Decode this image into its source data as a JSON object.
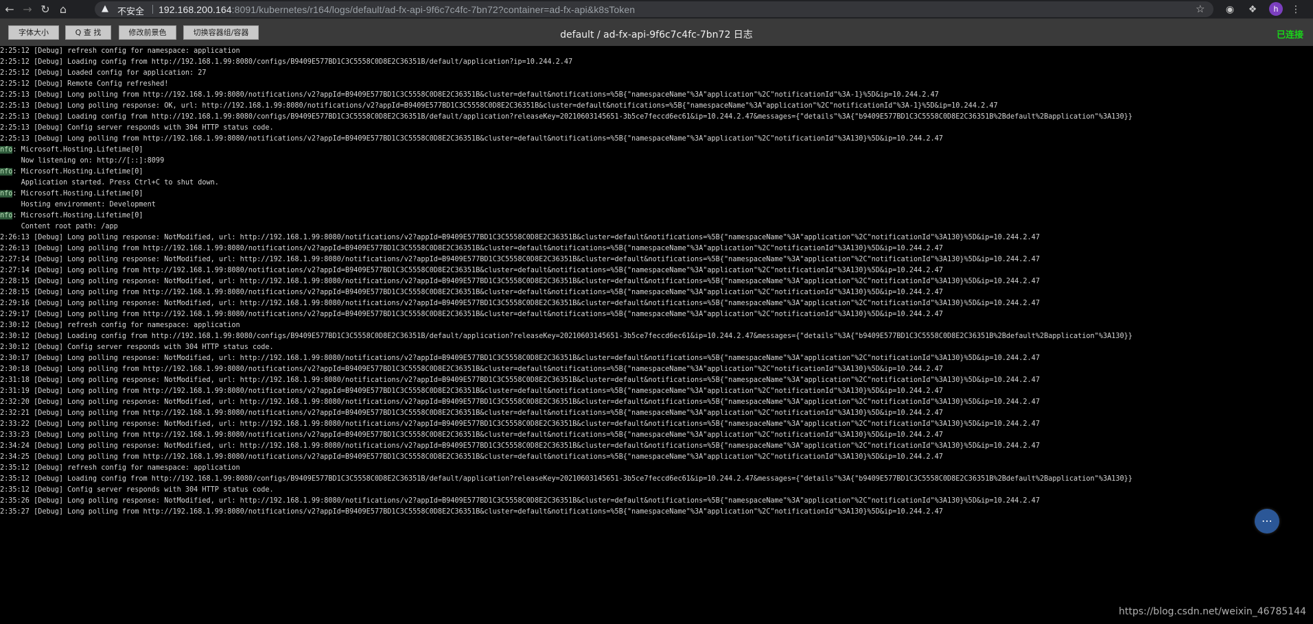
{
  "browser": {
    "back_icon": "arrow-left-icon",
    "forward_icon": "arrow-right-icon",
    "reload_icon": "reload-icon",
    "home_icon": "home-icon",
    "security_label": "不安全",
    "url_host": "192.168.200.164",
    "url_path": ":8091/kubernetes/r164/logs/default/ad-fx-api-9f6c7c4fc-7bn72?container=ad-fx-api&k8sToken",
    "avatar_letter": "h"
  },
  "toolbar": {
    "buttons": [
      "字体大小",
      "Q 查 找",
      "修改前景色",
      "切换容器组/容器"
    ],
    "title": "default / ad-fx-api-9f6c7c4fc-7bn72 日志",
    "status": "已连接"
  },
  "log_lines": [
    "2:25:12 [Debug] refresh config for namespace: application",
    "2:25:12 [Debug] Loading config from http://192.168.1.99:8080/configs/B9409E577BD1C3C5558C0D8E2C36351B/default/application?ip=10.244.2.47",
    "2:25:12 [Debug] Loaded config for application: 27",
    "2:25:12 [Debug] Remote Config refreshed!",
    "2:25:13 [Debug] Long polling from http://192.168.1.99:8080/notifications/v2?appId=B9409E577BD1C3C5558C0D8E2C36351B&cluster=default&notifications=%5B{\"namespaceName\"%3A\"application\"%2C\"notificationId\"%3A-1}%5D&ip=10.244.2.47",
    "2:25:13 [Debug] Long polling response: OK, url: http://192.168.1.99:8080/notifications/v2?appId=B9409E577BD1C3C5558C0D8E2C36351B&cluster=default&notifications=%5B{\"namespaceName\"%3A\"application\"%2C\"notificationId\"%3A-1}%5D&ip=10.244.2.47",
    "2:25:13 [Debug] Loading config from http://192.168.1.99:8080/configs/B9409E577BD1C3C5558C0D8E2C36351B/default/application?releaseKey=20210603145651-3b5ce7feccd6ec61&ip=10.244.2.47&messages={\"details\"%3A{\"b9409E577BD1C3C5558C0D8E2C36351B%2Bdefault%2Bapplication\"%3A130}}",
    "2:25:13 [Debug] Config server responds with 304 HTTP status code.",
    "2:25:13 [Debug] Long polling from http://192.168.1.99:8080/notifications/v2?appId=B9409E577BD1C3C5558C0D8E2C36351B&cluster=default&notifications=%5B{\"namespaceName\"%3A\"application\"%2C\"notificationId\"%3A130}%5D&ip=10.244.2.47",
    "nfo: Microsoft.Hosting.Lifetime[0]",
    "     Now listening on: http://[::]:8099",
    "nfo: Microsoft.Hosting.Lifetime[0]",
    "     Application started. Press Ctrl+C to shut down.",
    "nfo: Microsoft.Hosting.Lifetime[0]",
    "     Hosting environment: Development",
    "nfo: Microsoft.Hosting.Lifetime[0]",
    "     Content root path: /app",
    "2:26:13 [Debug] Long polling response: NotModified, url: http://192.168.1.99:8080/notifications/v2?appId=B9409E577BD1C3C5558C0D8E2C36351B&cluster=default&notifications=%5B{\"namespaceName\"%3A\"application\"%2C\"notificationId\"%3A130}%5D&ip=10.244.2.47",
    "2:26:13 [Debug] Long polling from http://192.168.1.99:8080/notifications/v2?appId=B9409E577BD1C3C5558C0D8E2C36351B&cluster=default&notifications=%5B{\"namespaceName\"%3A\"application\"%2C\"notificationId\"%3A130}%5D&ip=10.244.2.47",
    "2:27:14 [Debug] Long polling response: NotModified, url: http://192.168.1.99:8080/notifications/v2?appId=B9409E577BD1C3C5558C0D8E2C36351B&cluster=default&notifications=%5B{\"namespaceName\"%3A\"application\"%2C\"notificationId\"%3A130}%5D&ip=10.244.2.47",
    "2:27:14 [Debug] Long polling from http://192.168.1.99:8080/notifications/v2?appId=B9409E577BD1C3C5558C0D8E2C36351B&cluster=default&notifications=%5B{\"namespaceName\"%3A\"application\"%2C\"notificationId\"%3A130}%5D&ip=10.244.2.47",
    "2:28:15 [Debug] Long polling response: NotModified, url: http://192.168.1.99:8080/notifications/v2?appId=B9409E577BD1C3C5558C0D8E2C36351B&cluster=default&notifications=%5B{\"namespaceName\"%3A\"application\"%2C\"notificationId\"%3A130}%5D&ip=10.244.2.47",
    "2:28:15 [Debug] Long polling from http://192.168.1.99:8080/notifications/v2?appId=B9409E577BD1C3C5558C0D8E2C36351B&cluster=default&notifications=%5B{\"namespaceName\"%3A\"application\"%2C\"notificationId\"%3A130}%5D&ip=10.244.2.47",
    "2:29:16 [Debug] Long polling response: NotModified, url: http://192.168.1.99:8080/notifications/v2?appId=B9409E577BD1C3C5558C0D8E2C36351B&cluster=default&notifications=%5B{\"namespaceName\"%3A\"application\"%2C\"notificationId\"%3A130}%5D&ip=10.244.2.47",
    "2:29:17 [Debug] Long polling from http://192.168.1.99:8080/notifications/v2?appId=B9409E577BD1C3C5558C0D8E2C36351B&cluster=default&notifications=%5B{\"namespaceName\"%3A\"application\"%2C\"notificationId\"%3A130}%5D&ip=10.244.2.47",
    "2:30:12 [Debug] refresh config for namespace: application",
    "2:30:12 [Debug] Loading config from http://192.168.1.99:8080/configs/B9409E577BD1C3C5558C0D8E2C36351B/default/application?releaseKey=20210603145651-3b5ce7feccd6ec61&ip=10.244.2.47&messages={\"details\"%3A{\"b9409E577BD1C3C5558C0D8E2C36351B%2Bdefault%2Bapplication\"%3A130}}",
    "2:30:12 [Debug] Config server responds with 304 HTTP status code.",
    "2:30:17 [Debug] Long polling response: NotModified, url: http://192.168.1.99:8080/notifications/v2?appId=B9409E577BD1C3C5558C0D8E2C36351B&cluster=default&notifications=%5B{\"namespaceName\"%3A\"application\"%2C\"notificationId\"%3A130}%5D&ip=10.244.2.47",
    "2:30:18 [Debug] Long polling from http://192.168.1.99:8080/notifications/v2?appId=B9409E577BD1C3C5558C0D8E2C36351B&cluster=default&notifications=%5B{\"namespaceName\"%3A\"application\"%2C\"notificationId\"%3A130}%5D&ip=10.244.2.47",
    "2:31:18 [Debug] Long polling response: NotModified, url: http://192.168.1.99:8080/notifications/v2?appId=B9409E577BD1C3C5558C0D8E2C36351B&cluster=default&notifications=%5B{\"namespaceName\"%3A\"application\"%2C\"notificationId\"%3A130}%5D&ip=10.244.2.47",
    "2:31:19 [Debug] Long polling from http://192.168.1.99:8080/notifications/v2?appId=B9409E577BD1C3C5558C0D8E2C36351B&cluster=default&notifications=%5B{\"namespaceName\"%3A\"application\"%2C\"notificationId\"%3A130}%5D&ip=10.244.2.47",
    "2:32:20 [Debug] Long polling response: NotModified, url: http://192.168.1.99:8080/notifications/v2?appId=B9409E577BD1C3C5558C0D8E2C36351B&cluster=default&notifications=%5B{\"namespaceName\"%3A\"application\"%2C\"notificationId\"%3A130}%5D&ip=10.244.2.47",
    "2:32:21 [Debug] Long polling from http://192.168.1.99:8080/notifications/v2?appId=B9409E577BD1C3C5558C0D8E2C36351B&cluster=default&notifications=%5B{\"namespaceName\"%3A\"application\"%2C\"notificationId\"%3A130}%5D&ip=10.244.2.47",
    "2:33:22 [Debug] Long polling response: NotModified, url: http://192.168.1.99:8080/notifications/v2?appId=B9409E577BD1C3C5558C0D8E2C36351B&cluster=default&notifications=%5B{\"namespaceName\"%3A\"application\"%2C\"notificationId\"%3A130}%5D&ip=10.244.2.47",
    "2:33:23 [Debug] Long polling from http://192.168.1.99:8080/notifications/v2?appId=B9409E577BD1C3C5558C0D8E2C36351B&cluster=default&notifications=%5B{\"namespaceName\"%3A\"application\"%2C\"notificationId\"%3A130}%5D&ip=10.244.2.47",
    "2:34:24 [Debug] Long polling response: NotModified, url: http://192.168.1.99:8080/notifications/v2?appId=B9409E577BD1C3C5558C0D8E2C36351B&cluster=default&notifications=%5B{\"namespaceName\"%3A\"application\"%2C\"notificationId\"%3A130}%5D&ip=10.244.2.47",
    "2:34:25 [Debug] Long polling from http://192.168.1.99:8080/notifications/v2?appId=B9409E577BD1C3C5558C0D8E2C36351B&cluster=default&notifications=%5B{\"namespaceName\"%3A\"application\"%2C\"notificationId\"%3A130}%5D&ip=10.244.2.47",
    "2:35:12 [Debug] refresh config for namespace: application",
    "2:35:12 [Debug] Loading config from http://192.168.1.99:8080/configs/B9409E577BD1C3C5558C0D8E2C36351B/default/application?releaseKey=20210603145651-3b5ce7feccd6ec61&ip=10.244.2.47&messages={\"details\"%3A{\"b9409E577BD1C3C5558C0D8E2C36351B%2Bdefault%2Bapplication\"%3A130}}",
    "2:35:12 [Debug] Config server responds with 304 HTTP status code.",
    "2:35:26 [Debug] Long polling response: NotModified, url: http://192.168.1.99:8080/notifications/v2?appId=B9409E577BD1C3C5558C0D8E2C36351B&cluster=default&notifications=%5B{\"namespaceName\"%3A\"application\"%2C\"notificationId\"%3A130}%5D&ip=10.244.2.47",
    "2:35:27 [Debug] Long polling from http://192.168.1.99:8080/notifications/v2?appId=B9409E577BD1C3C5558C0D8E2C36351B&cluster=default&notifications=%5B{\"namespaceName\"%3A\"application\"%2C\"notificationId\"%3A130}%5D&ip=10.244.2.47"
  ],
  "chat_icon": "chat-bubble-icon",
  "watermark": "https://blog.csdn.net/weixin_46785144",
  "colors": {
    "connected": "#19d619",
    "log_text": "#d6d6d6",
    "background": "#000000"
  }
}
